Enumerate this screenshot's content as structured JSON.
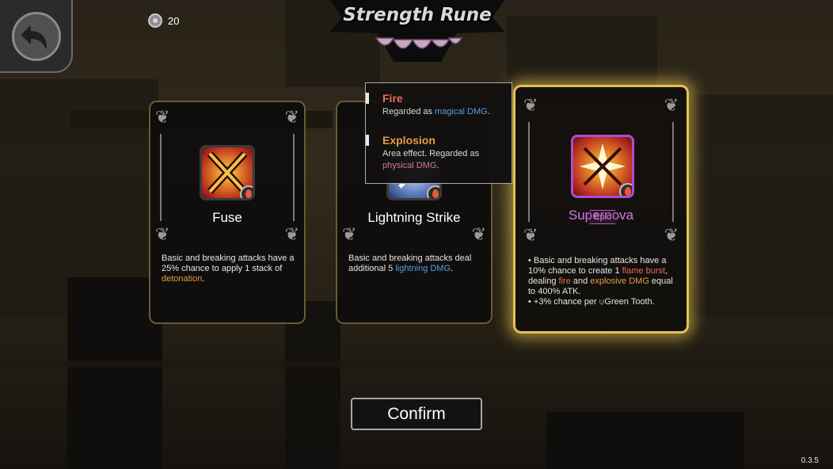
{
  "header": {
    "title": "Strength Rune",
    "currency_count": "20"
  },
  "cards": [
    {
      "name": "Fuse",
      "desc_parts": [
        "Basic and breaking attacks have a 25% chance to apply 1 stack of ",
        "detonation",
        "."
      ],
      "icon": "fuse-rune-icon"
    },
    {
      "name": "Lightning Strike",
      "desc_parts": [
        "Basic and breaking attacks deal additional 5 ",
        "lightning DMG",
        "."
      ],
      "icon": "lightning-rune-icon"
    },
    {
      "name": "Supernova",
      "rarity": "Epic",
      "desc_line1_parts": [
        "• Basic and breaking attacks have a 10% chance to create 1 ",
        "flame burst",
        ", dealing ",
        "fire",
        " and ",
        "explosive DMG",
        " equal to 400% ATK."
      ],
      "desc_line2_parts": [
        "• +3% chance per ",
        "Green Tooth",
        "."
      ],
      "icon": "supernova-rune-icon"
    }
  ],
  "tooltip": {
    "fire_title": "Fire",
    "fire_text_a": "Regarded as ",
    "fire_text_b": "magical DMG",
    "fire_text_c": ".",
    "explosion_title": "Explosion",
    "explosion_text_a": "Area effect. Regarded as ",
    "explosion_text_b": "physical DMG",
    "explosion_text_c": "."
  },
  "confirm_label": "Confirm",
  "version": "0.3.5",
  "colors": {
    "selected_border": "#e5c154",
    "epic": "#c98ad0",
    "fire_title": "#ea6a55",
    "explosion_title": "#e79a47",
    "keyword_blue": "#5a9ee0"
  }
}
